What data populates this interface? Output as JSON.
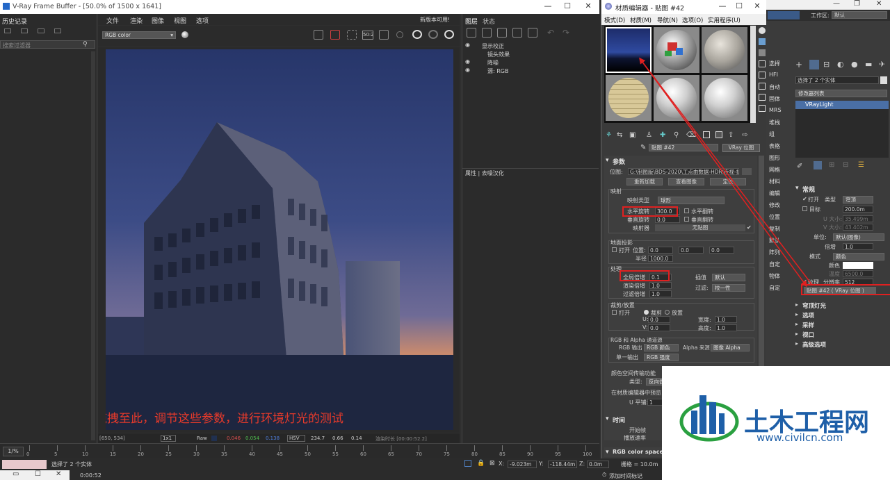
{
  "vfb": {
    "title": "V-Ray Frame Buffer - [50.0% of 1500 x 1641]",
    "history_title": "历史记录",
    "search_placeholder": "搜索过滤器",
    "menus": [
      "文件",
      "渲染",
      "图像",
      "视图",
      "选项"
    ],
    "update_notice": "新版本可用!",
    "channel": "RGB color",
    "compare_btn": "50:2",
    "layers_tabs": [
      "图层",
      "状态"
    ],
    "layers": [
      "显示校正",
      "镜头效果",
      "降噪",
      "源: RGB"
    ],
    "props_header": "属性 | 去噪汉化",
    "status": {
      "coords": "[650, 534]",
      "ratio": "1x1",
      "raw": "Raw",
      "r": "0.046",
      "g": "0.054",
      "b": "0.138",
      "mode": "HSV",
      "h": "234.7",
      "s": "0.66",
      "v": "0.14",
      "render_time": "渲染时长 [00:00:52.2]"
    },
    "annotation": "将灯光拖拽至此，调节这些参数，进行环境灯光的测试"
  },
  "timeline": {
    "ticks": [
      "0",
      "5",
      "10",
      "15",
      "20",
      "25",
      "30",
      "35",
      "40",
      "45",
      "50",
      "55",
      "60",
      "65",
      "70",
      "75",
      "80",
      "85",
      "90",
      "95",
      "100"
    ],
    "frame_label": "1/%"
  },
  "max_status": {
    "selection": "选择了 2 个实体",
    "time": "0:00:52",
    "x_label": "X:",
    "x_val": "-9.023m",
    "y_label": "Y:",
    "y_val": "-118.44m",
    "z_label": "Z:",
    "z_val": "0.0m",
    "grid": "栅格 = 10.0m",
    "add_tag": "添加时间标记"
  },
  "mat": {
    "title": "材质编辑器 - 贴图 #42",
    "menus": [
      "模式(D)",
      "材质(M)",
      "导航(N)",
      "选项(O)",
      "实用程序(U)"
    ],
    "map_name": "贴图 #42",
    "map_type": "VRay 位图",
    "params_title": "参数",
    "path_label": "位图:",
    "path_value": "G:\\制图版\\BDS-2020\\工点由数据-HDRI夜视-扩",
    "reload_btn": "重新加载",
    "view_btn": "查看图像",
    "locate_btn": "定位",
    "mapping_group": "映射",
    "mapping_type_label": "映射类型",
    "mapping_type": "球形",
    "h_rot_label": "水平旋转",
    "h_rot": "300.0",
    "h_flip": "水平翻转",
    "v_rot_label": "垂直旋转",
    "v_rot": "0.0",
    "v_flip": "垂直翻转",
    "mapper_label": "映射器",
    "mapper_value": "无贴图",
    "ground_group": "地面投影",
    "ground_on": "打开",
    "pos_label": "位置:",
    "pos_vals": [
      "0.0",
      "0.0",
      "0.0"
    ],
    "radius_label": "半径",
    "radius": "1000.0",
    "process_group": "处理",
    "overall_mult_label": "全局倍增",
    "overall_mult": "0.1",
    "render_mult_label": "渲染倍增",
    "render_mult": "1.0",
    "interp_label": "插值",
    "interp_value": "默认",
    "filter_mult_label": "过滤倍增",
    "filter_mult": "1.0",
    "filter_label": "过滤:",
    "filter_value": "校一性",
    "crop_group": "裁剪/放置",
    "crop_on": "打开",
    "crop_mode_a": "裁剪",
    "crop_mode_b": "放置",
    "u_label": "U:",
    "u_val": "0.0",
    "w_label": "宽度:",
    "w_val": "1.0",
    "v_label": "V:",
    "v_val": "0.0",
    "h_label": "高度:",
    "h_val": "1.0",
    "alpha_group": "RGB 和 Alpha 通道源",
    "rgb_out_label": "RGB 输出",
    "rgb_out": "RGB 颜色",
    "alpha_src_label": "Alpha 来源",
    "alpha_src": "图像 Alpha",
    "mono_out_label": "单一输出",
    "mono_out": "RGB 强度",
    "color_space_label": "颜色空间传输功能",
    "type_label": "类型:",
    "type_value": "反向伽",
    "preview_label": "在材质编辑器中预览",
    "u_tiling_label": "U 平铺:",
    "u_tiling": "1",
    "time_title": "时间",
    "start_frame_label": "开始帧",
    "playback_rate_label": "播放速率",
    "color_space_title": "RGB color space"
  },
  "cmd": {
    "workspace_label": "工作区:",
    "workspace_value": "默认",
    "selection_info": "选择了 2 个实体",
    "modifier_list": "修改器列表",
    "stack_item": "VRayLight",
    "side_labels": [
      "选择",
      "HFI",
      "自动",
      "固体",
      "MRS",
      "堆栈",
      "组",
      "表格",
      "图形",
      "网格",
      "材料",
      "编辑",
      "修改",
      "位置",
      "复制",
      "默认",
      "阵列",
      "自定",
      "物体",
      "自定"
    ],
    "general_title": "常规",
    "on_label": "打开",
    "type_label": "类型",
    "type_value": "穹顶",
    "target_label": "目标",
    "target_value": "200.0m",
    "length_label": "U 大小:",
    "length_value": "35.499m",
    "width_label": "V 大小:",
    "width_value": "43.402m",
    "units_label": "单位:",
    "units_value": "默认(图像)",
    "multiplier_label": "倍增",
    "multiplier_value": "1.0",
    "mode_label": "模式",
    "mode_value": "颜色",
    "color_label": "颜色",
    "temp_label": "温度",
    "temp_value": "6500.0",
    "texture_label": "纹理",
    "resolution_label": "分辨率",
    "resolution_value": "512",
    "texture_map": "贴图 #42 ( VRay 位图 )",
    "sections": [
      "穹顶灯光",
      "选项",
      "采样",
      "视口",
      "高级选项"
    ]
  },
  "logo": {
    "cn": "土木工程网",
    "url": "www.civilcn.com"
  },
  "colors": {
    "accent_red": "#e02020",
    "annotation_red": "#e83a2a",
    "selection_blue": "#4a6fa5",
    "logo_blue": "#1e5fa8"
  }
}
